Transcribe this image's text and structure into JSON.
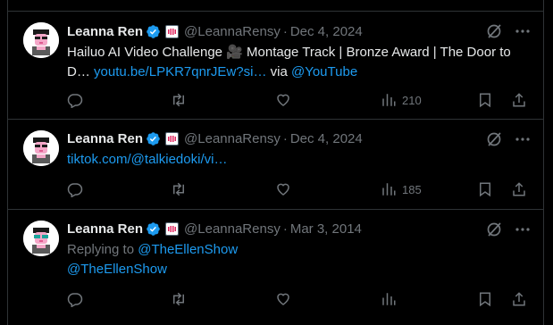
{
  "colors": {
    "background": "#000000",
    "text": "#e7e9ea",
    "muted": "#71767b",
    "link": "#1d9bf0",
    "verified": "#1d9bf0",
    "border": "#2f3336"
  },
  "tweets": [
    {
      "name": "Leanna Ren",
      "handle": "@LeannaRensy",
      "date": "Dec 4, 2024",
      "text_before": "Hailuo AI Video Challenge 🎥 Montage Track | Bronze Award | The Door to D…",
      "link": "youtu.be/LPKR7qnrJEw?si…",
      "via": "via",
      "mention": "@YouTube",
      "views": "210",
      "icons": [
        "verified-badge-icon",
        "affiliate-badge-icon",
        "grok-icon",
        "more-icon",
        "reply-icon",
        "retweet-icon",
        "like-icon",
        "views-icon",
        "bookmark-icon",
        "share-icon"
      ]
    },
    {
      "name": "Leanna Ren",
      "handle": "@LeannaRensy",
      "date": "Dec 4, 2024",
      "link": "tiktok.com/@talkiedoki/vi…",
      "views": "185"
    },
    {
      "name": "Leanna Ren",
      "handle": "@LeannaRensy",
      "date": "Mar 3, 2014",
      "replying_to_label": "Replying to",
      "replying_to": "@TheEllenShow",
      "mention": "@TheEllenShow"
    }
  ],
  "separator": "·"
}
